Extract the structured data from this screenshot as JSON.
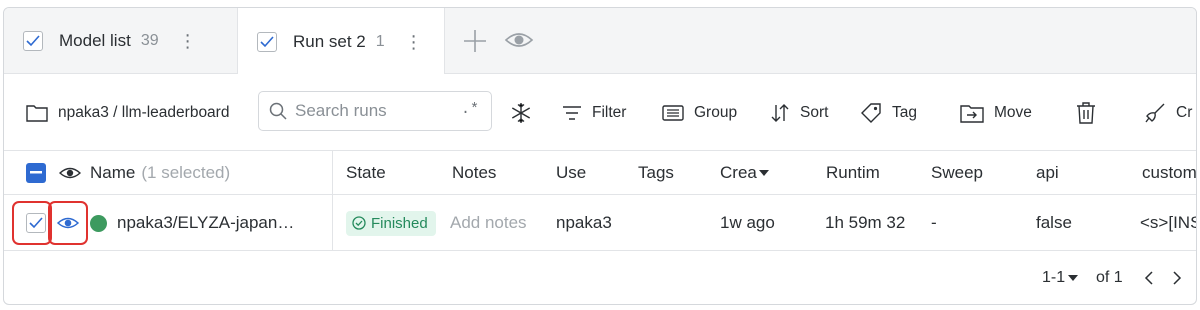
{
  "tabs": [
    {
      "label": "Model list",
      "count": "39",
      "checked": true
    },
    {
      "label": "Run set 2",
      "count": "1",
      "checked": true
    }
  ],
  "toolbar": {
    "project": "npaka3 / llm-leaderboard",
    "search_placeholder": "Search runs",
    "regex_label": ".*",
    "filter": "Filter",
    "group": "Group",
    "sort": "Sort",
    "tag": "Tag",
    "move": "Move",
    "crop_label": "Cr"
  },
  "columns": {
    "name": "Name",
    "name_selected": "(1 selected)",
    "state": "State",
    "notes": "Notes",
    "user": "Use",
    "tags": "Tags",
    "created": "Crea",
    "runtime": "Runtim",
    "sweep": "Sweep",
    "api": "api",
    "custom": "custom"
  },
  "rows": [
    {
      "name": "npaka3/ELYZA-japan…",
      "state": "Finished",
      "notes_placeholder": "Add notes",
      "user": "npaka3",
      "tags": "",
      "created": "1w ago",
      "runtime": "1h 59m 32",
      "sweep": "-",
      "api": "false",
      "custom": "<s>[INST"
    }
  ],
  "pagination": {
    "range": "1-1",
    "of": "of 1"
  },
  "colors": {
    "accent": "#2e6ad1",
    "run_dot": "#3d9a5f",
    "finished_bg": "#e2f5ec",
    "finished_text": "#248a5c",
    "highlight": "#e0322f"
  }
}
